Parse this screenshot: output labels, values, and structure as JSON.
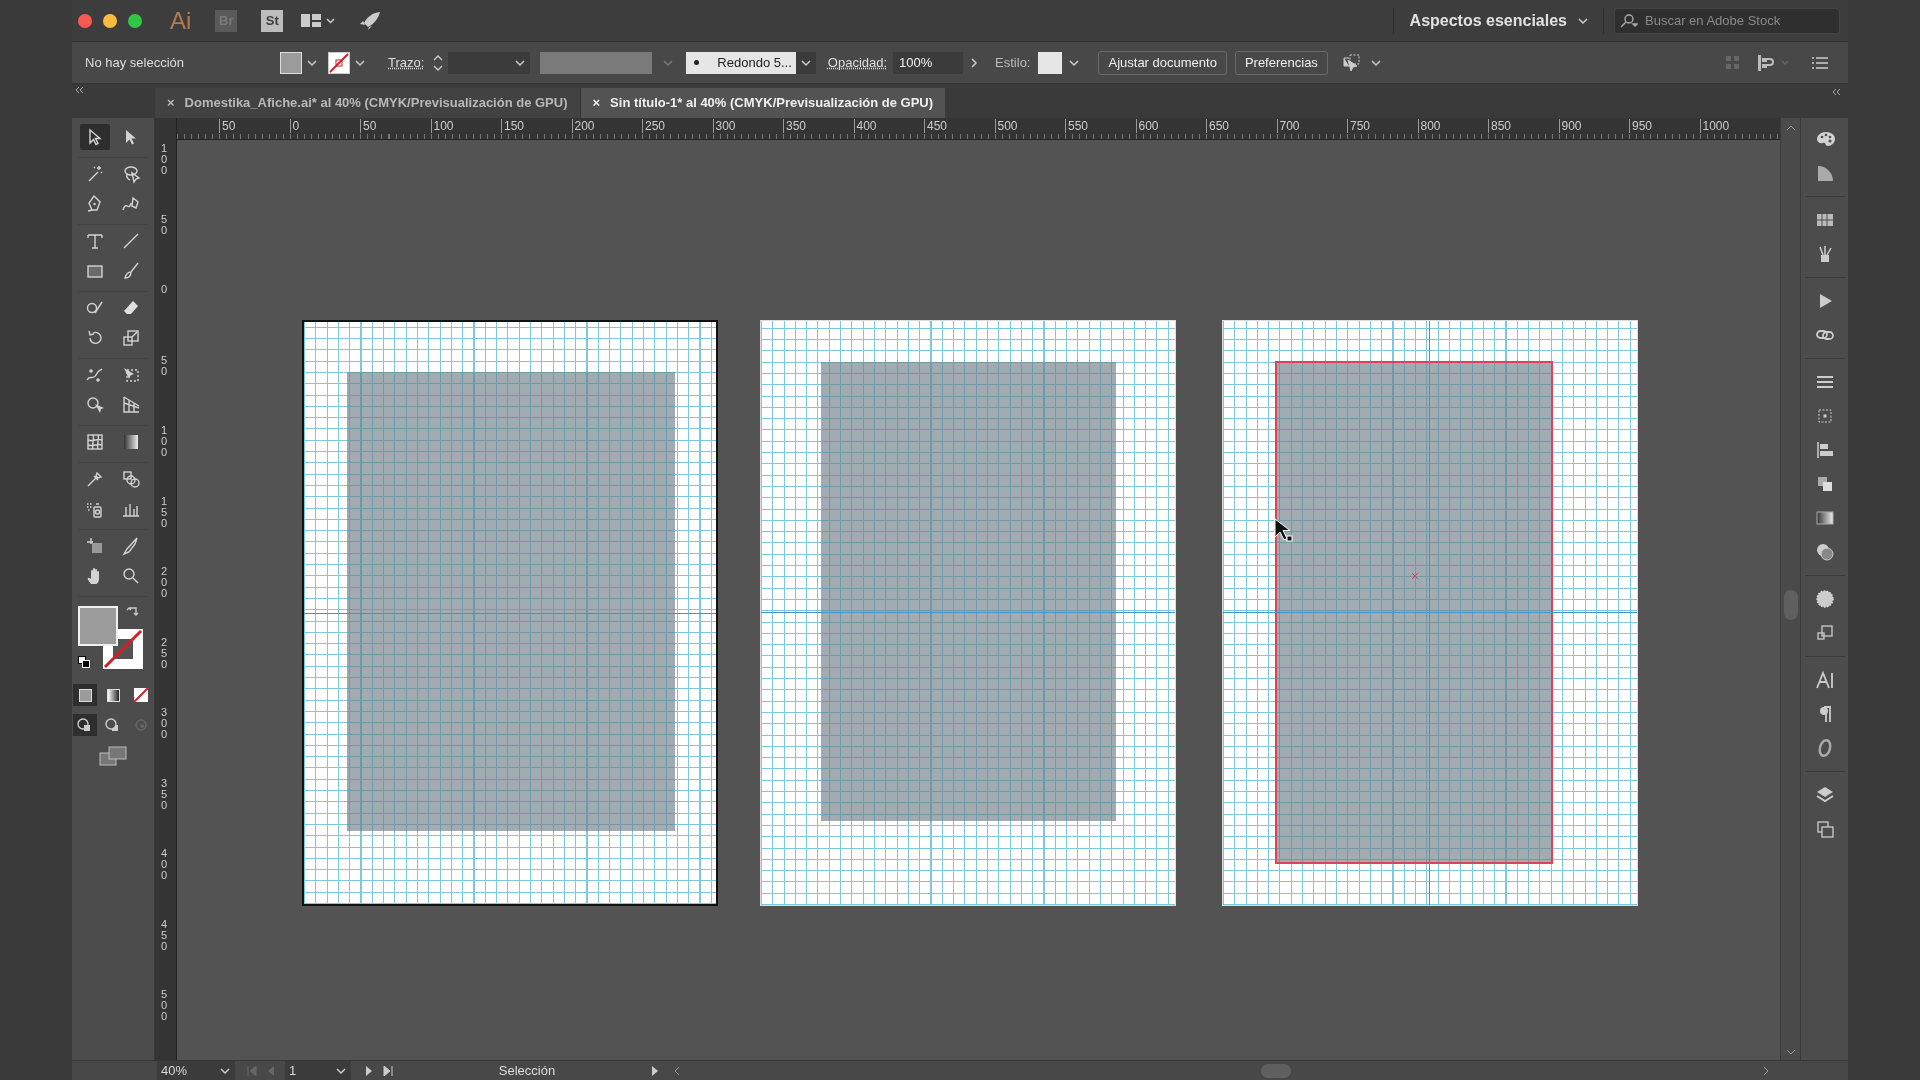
{
  "title_bar": {
    "app_logo": "Ai",
    "bridge_logo": "Br",
    "stock_logo": "St",
    "workspace": "Aspectos esenciales",
    "search": {
      "placeholder": "Buscar en Adobe Stock"
    }
  },
  "control_bar": {
    "selection": "No hay selección",
    "stroke_label": "Trazo:",
    "brush": "Redondo 5...",
    "opacity_label": "Opacidad:",
    "opacity": "100%",
    "style_label": "Estilo:",
    "buttons": [
      "Ajustar documento",
      "Preferencias"
    ]
  },
  "tabs": [
    {
      "close": "×",
      "label": "Domestika_Afiche.ai* al 40% (CMYK/Previsualización de GPU)",
      "selected": false
    },
    {
      "close": "×",
      "label": "Sin título-1* al 40% (CMYK/Previsualización de GPU)",
      "selected": true
    }
  ],
  "toolbar": {
    "tools": [
      {
        "kind": "selection",
        "selected": true
      },
      {
        "kind": "direct",
        "selected": false
      },
      {
        "kind": "wand",
        "selected": false
      },
      {
        "kind": "lasso",
        "selected": false
      },
      {
        "kind": "pen",
        "selected": false
      },
      {
        "kind": "curvature",
        "selected": false
      },
      {
        "kind": "type",
        "selected": false
      },
      {
        "kind": "line",
        "selected": false
      },
      {
        "kind": "rectangle",
        "selected": false
      },
      {
        "kind": "brush",
        "selected": false
      },
      {
        "kind": "shaper",
        "selected": false
      },
      {
        "kind": "eraser",
        "selected": false
      },
      {
        "kind": "rotate",
        "selected": false
      },
      {
        "kind": "scale",
        "selected": false
      },
      {
        "kind": "puppet",
        "selected": false
      },
      {
        "kind": "transform",
        "selected": false
      },
      {
        "kind": "builder",
        "selected": false
      },
      {
        "kind": "perspective",
        "selected": false
      },
      {
        "kind": "mesh",
        "selected": false
      },
      {
        "kind": "gradient",
        "selected": false
      },
      {
        "kind": "eyedropper",
        "selected": false
      },
      {
        "kind": "blend",
        "selected": false
      },
      {
        "kind": "sprayer",
        "selected": false
      },
      {
        "kind": "graph",
        "selected": false
      },
      {
        "kind": "artboard",
        "selected": false
      },
      {
        "kind": "knife",
        "selected": false
      },
      {
        "kind": "hand",
        "selected": false
      },
      {
        "kind": "zoom",
        "selected": false
      }
    ]
  },
  "rulers": {
    "horizontal": [
      "50",
      "0",
      "50",
      "100",
      "150",
      "200",
      "250",
      "300",
      "350",
      "400",
      "450",
      "500",
      "550",
      "600",
      "650",
      "700",
      "750",
      "800",
      "850",
      "900",
      "950",
      "1000"
    ],
    "vertical": [
      "100",
      "50",
      "0",
      "50",
      "100",
      "150",
      "200",
      "250",
      "300",
      "350",
      "400",
      "450",
      "500"
    ]
  },
  "artboards": [
    {
      "active": true,
      "highlighted": false
    },
    {
      "active": false,
      "highlighted": false
    },
    {
      "active": false,
      "highlighted": true
    }
  ],
  "status_bar": {
    "zoom": "40%",
    "artboard": "1",
    "tool": "Selección"
  }
}
